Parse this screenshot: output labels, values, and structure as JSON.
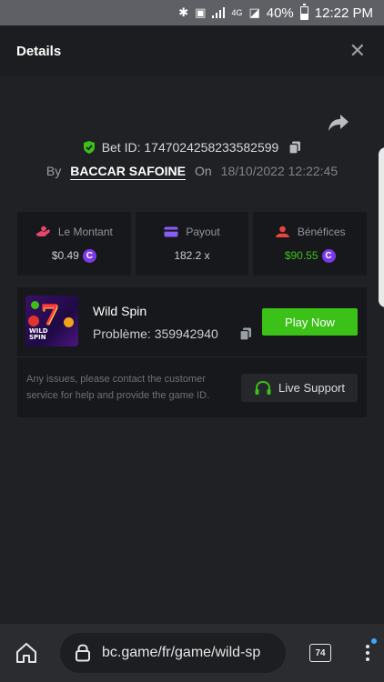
{
  "statusbar": {
    "battery": "40%",
    "time": "12:22 PM",
    "network": "4G"
  },
  "header": {
    "title": "Details"
  },
  "bet": {
    "id_label": "Bet ID: 1747024258233582599",
    "by_label": "By",
    "username": "BACCAR SAFOINE",
    "on_label": "On",
    "date": "18/10/2022 12:22:45"
  },
  "stats": {
    "amount_label": "Le Montant",
    "amount_value": "$0.49",
    "payout_label": "Payout",
    "payout_value": "182.2 x",
    "profit_label": "Bénéfices",
    "profit_value": "$90.55",
    "profit_color": "#3bc117"
  },
  "game": {
    "name": "Wild Spin",
    "problem_label": "Problème: 359942940",
    "play_label": "Play Now",
    "thumb_text_line1": "WILD",
    "thumb_text_line2": "SPIN",
    "note": "Any issues, please contact the customer service for help and provide the game ID.",
    "support_label": "Live Support"
  },
  "browser": {
    "url": "bc.game/fr/game/wild-sp",
    "tab_count": "74"
  },
  "colors": {
    "accent_green": "#3bc117",
    "coin_purple": "#7c3ae6",
    "background": "#202124"
  }
}
